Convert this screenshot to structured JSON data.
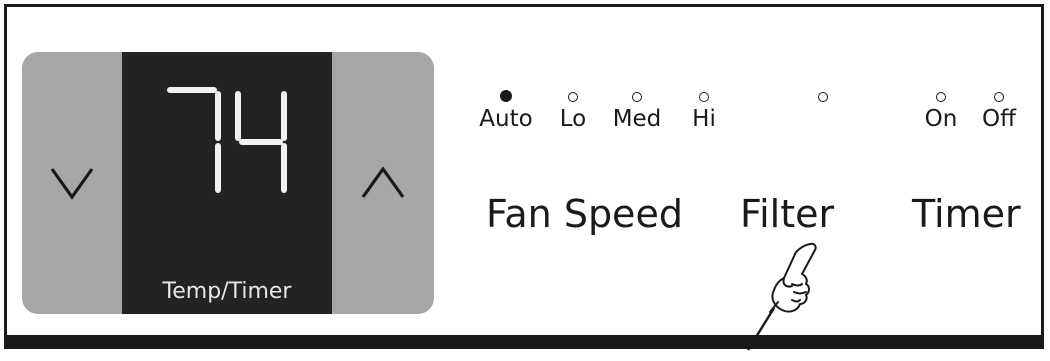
{
  "display": {
    "temperature": "74",
    "caption": "Temp/Timer"
  },
  "buttons": {
    "down_icon": "chevron-down-icon",
    "up_icon": "chevron-up-icon"
  },
  "fan_speed": {
    "title": "Fan Speed",
    "options": [
      {
        "label": "Auto",
        "active": true
      },
      {
        "label": "Lo",
        "active": false
      },
      {
        "label": "Med",
        "active": false
      },
      {
        "label": "Hi",
        "active": false
      }
    ]
  },
  "filter": {
    "title": "Filter",
    "active": false
  },
  "timer": {
    "title": "Timer",
    "options": [
      {
        "label": "On",
        "active": false
      },
      {
        "label": "Off",
        "active": false
      }
    ]
  },
  "colors": {
    "panel_gray": "#a7a7a7",
    "display_bg": "#232323",
    "ink": "#1a1a1a"
  }
}
